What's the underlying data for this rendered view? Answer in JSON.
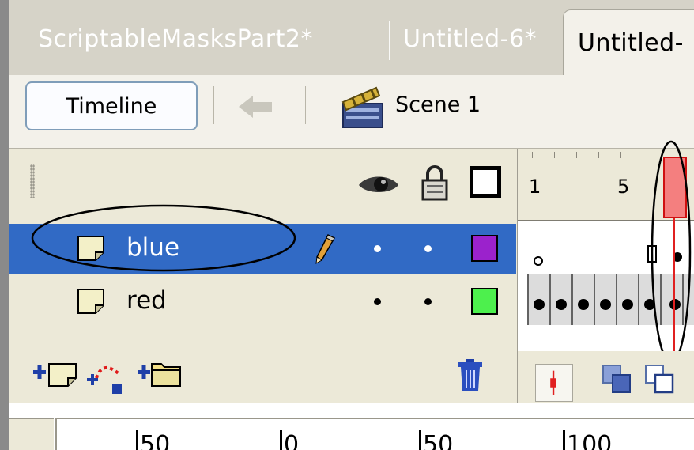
{
  "tabs": [
    {
      "label": "ScriptableMasksPart2*",
      "active": false
    },
    {
      "label": "Untitled-6*",
      "active": false
    },
    {
      "label": "Untitled-",
      "active": true
    }
  ],
  "edit_bar": {
    "timeline_label": "Timeline",
    "back_icon": "arrow-left-icon",
    "scene_icon": "clapperboard-icon",
    "scene_label": "Scene 1"
  },
  "layer_header": {
    "icons": [
      "eye-icon",
      "lock-icon",
      "outline-icon"
    ]
  },
  "layers": [
    {
      "name": "blue",
      "selected": true,
      "editing": true,
      "color": "#9b22cc"
    },
    {
      "name": "red",
      "selected": false,
      "editing": false,
      "color": "#4df04d"
    }
  ],
  "frame_ruler": {
    "labels": [
      "1",
      "5"
    ],
    "current_frame_color": "#f47f7f"
  },
  "layer_toolbar": {
    "icons": [
      "insert-layer-icon",
      "add-motion-guide-icon",
      "insert-layer-folder-icon",
      "trash-icon"
    ]
  },
  "frame_toolbar": {
    "icons": [
      "center-frame-icon",
      "onion-skin-icon",
      "onion-skin-outlines-icon"
    ]
  },
  "stage_ruler": {
    "labels": [
      "50",
      "0",
      "50",
      "100"
    ]
  },
  "colors": {
    "selection": "#316ac5",
    "panel": "#ece9d8",
    "annotation_ink": "#000000"
  }
}
